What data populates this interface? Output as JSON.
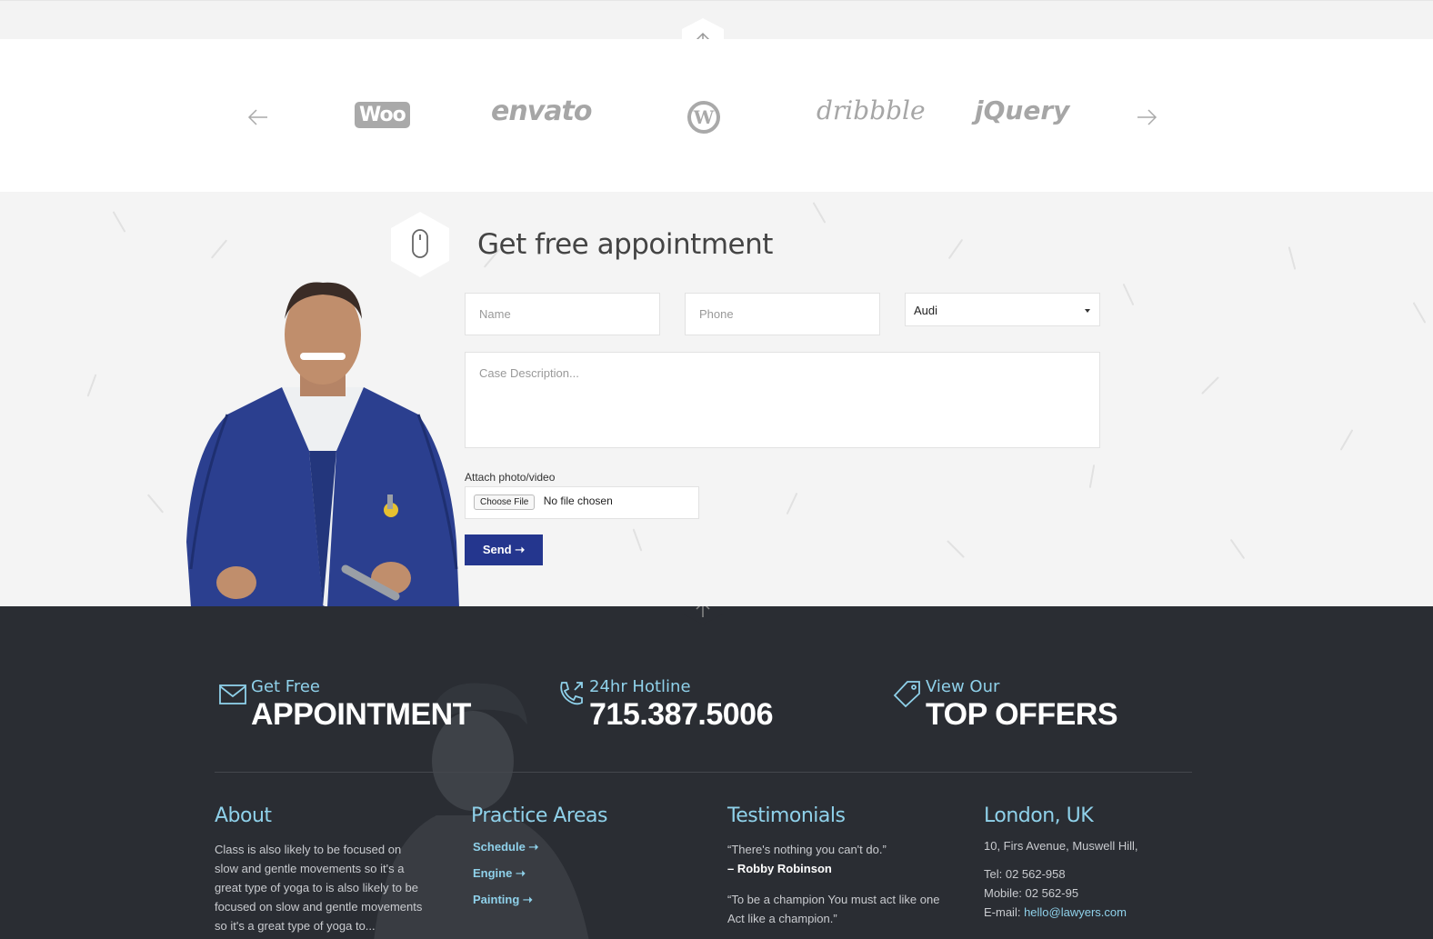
{
  "logos": {
    "items": [
      "Woo",
      "envato",
      "W",
      "dribbble",
      "jQuery"
    ]
  },
  "appointment": {
    "title": "Get free appointment",
    "name_placeholder": "Name",
    "phone_placeholder": "Phone",
    "select_value": "Audi",
    "description_placeholder": "Case Description...",
    "attach_label": "Attach photo/video",
    "choose_file": "Choose File",
    "no_file": "No file chosen",
    "send_label": "Send ➝"
  },
  "footer": {
    "ctas": [
      {
        "small": "Get Free",
        "big": "APPOINTMENT",
        "icon": "envelope-icon"
      },
      {
        "small": "24hr Hotline",
        "big": "715.387.5006",
        "icon": "phone-icon"
      },
      {
        "small": "View Our",
        "big": "TOP OFFERS",
        "icon": "tag-icon"
      }
    ],
    "about": {
      "title": "About",
      "text": "Class is also likely to be focused on slow and gentle movements so it's a great type of yoga to is also likely to be focused on slow and gentle movements so it's a great type of yoga to..."
    },
    "practice": {
      "title": "Practice Areas",
      "links": [
        "Schedule ➝",
        "Engine ➝",
        "Painting ➝"
      ]
    },
    "testimonials": {
      "title": "Testimonials",
      "quotes": [
        {
          "text": "“There's nothing you can't do.”",
          "author": "– Robby Robinson"
        },
        {
          "text": "“To be a champion You must act like one Act like a champion.”",
          "author": ""
        }
      ]
    },
    "contact": {
      "title": "London, UK",
      "address": "10, Firs Avenue, Muswell Hill,",
      "tel": "Tel: 02 562-958",
      "mobile": "Mobile: 02 562-95",
      "email_label": "E-mail: ",
      "email": "hello@lawyers.com"
    }
  },
  "colors": {
    "accent": "#8fd1ea",
    "button": "#24368e",
    "footer_bg": "#2a2d33"
  }
}
